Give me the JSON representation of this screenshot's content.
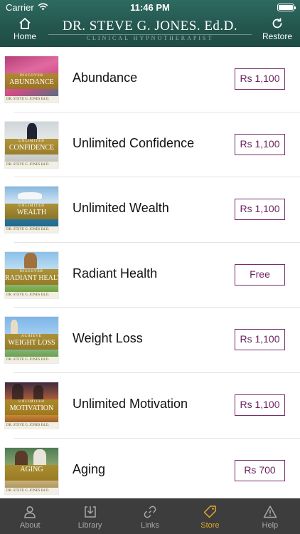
{
  "status_bar": {
    "carrier": "Carrier",
    "time": "11:46 PM"
  },
  "header": {
    "home_label": "Home",
    "restore_label": "Restore",
    "brand_name": "DR. STEVE G. JONES. Ed.D.",
    "brand_subtitle": "CLINICAL HYPNOTHERAPIST",
    "home_icon": "home-icon",
    "restore_icon": "restore-icon"
  },
  "products": [
    {
      "title": "Abundance",
      "price": "Rs 1,100",
      "thumb_small": "DISCOVER",
      "thumb_big": "ABUNDANCE",
      "thumb_foot": "DR. STEVE G. JONES Ed.D."
    },
    {
      "title": "Unlimited Confidence",
      "price": "Rs 1,100",
      "thumb_small": "UNLIMITED",
      "thumb_big": "CONFIDENCE",
      "thumb_foot": "DR. STEVE G. JONES Ed.D."
    },
    {
      "title": "Unlimited Wealth",
      "price": "Rs 1,100",
      "thumb_small": "UNLIMITED",
      "thumb_big": "WEALTH",
      "thumb_foot": "DR. STEVE G. JONES Ed.D."
    },
    {
      "title": "Radiant Health",
      "price": "Free",
      "thumb_small": "DISCOVER",
      "thumb_big": "RADIANT HEALTH",
      "thumb_foot": "DR. STEVE G. JONES Ed.D."
    },
    {
      "title": "Weight Loss",
      "price": "Rs 1,100",
      "thumb_small": "ACHIEVE",
      "thumb_big": "WEIGHT LOSS",
      "thumb_foot": "DR. STEVE G. JONES Ed.D."
    },
    {
      "title": "Unlimited Motivation",
      "price": "Rs 1,100",
      "thumb_small": "UNLIMITED",
      "thumb_big": "MOTIVATION",
      "thumb_foot": "DR. STEVE G. JONES Ed.D."
    },
    {
      "title": "Aging",
      "price": "Rs 700",
      "thumb_small": "",
      "thumb_big": "AGING",
      "thumb_foot": "DR. STEVE G. JONES Ed.D."
    }
  ],
  "tabs": [
    {
      "label": "About",
      "icon": "person-icon",
      "active": false
    },
    {
      "label": "Library",
      "icon": "download-icon",
      "active": false
    },
    {
      "label": "Links",
      "icon": "link-icon",
      "active": false
    },
    {
      "label": "Store",
      "icon": "tag-icon",
      "active": true
    },
    {
      "label": "Help",
      "icon": "warning-icon",
      "active": false
    }
  ],
  "colors": {
    "header_bg": "#24574f",
    "price_border": "#7a2c6b",
    "tab_active": "#e0a92e",
    "tab_inactive": "#a9a9a9",
    "tabbar_bg": "#3d3d3d"
  }
}
